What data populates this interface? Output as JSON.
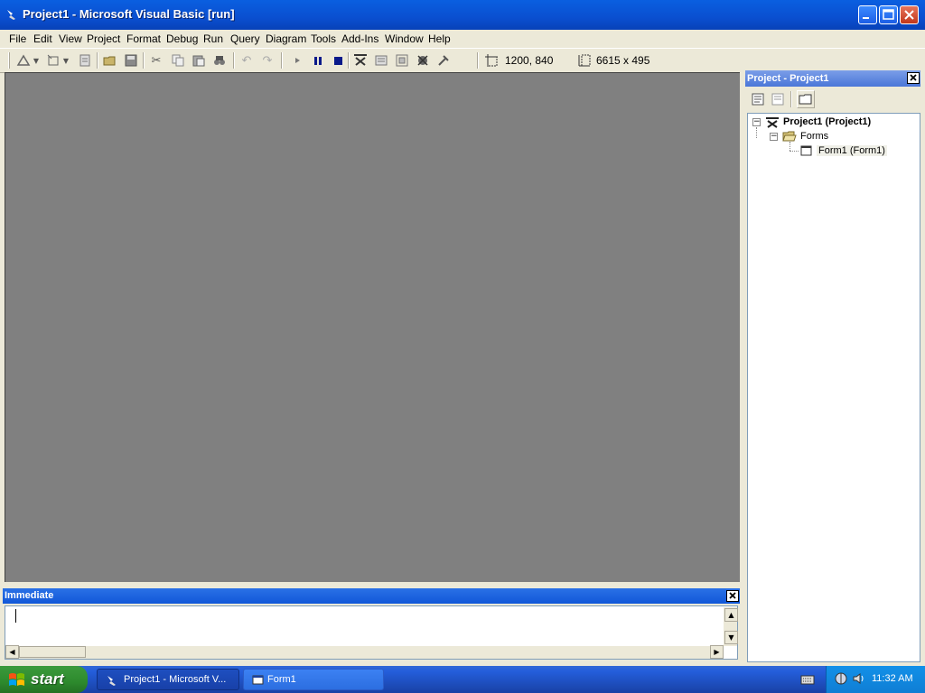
{
  "window": {
    "title": "Project1 - Microsoft Visual Basic [run]"
  },
  "menu": [
    {
      "label": "File"
    },
    {
      "label": "Edit"
    },
    {
      "label": "View"
    },
    {
      "label": "Project"
    },
    {
      "label": "Format"
    },
    {
      "label": "Debug"
    },
    {
      "label": "Run"
    },
    {
      "label": "Query"
    },
    {
      "label": "Diagram"
    },
    {
      "label": "Tools"
    },
    {
      "label": "Add-Ins"
    },
    {
      "label": "Window"
    },
    {
      "label": "Help"
    }
  ],
  "toolbar": {
    "position": "1200, 840",
    "size": "6615 x 495"
  },
  "immediate": {
    "title": "Immediate",
    "value": ""
  },
  "project_explorer": {
    "title": "Project - Project1",
    "root": "Project1 (Project1)",
    "folder": "Forms",
    "item": "Form1 (Form1)"
  },
  "taskbar": {
    "start_label": "start",
    "tasks": [
      {
        "label": "Project1 - Microsoft V..."
      },
      {
        "label": "Form1"
      }
    ],
    "clock": "11:32 AM"
  },
  "colors": {
    "titlebar": "#0a55de",
    "mdi_background": "#808080",
    "taskbar": "#245edb",
    "start_button": "#2d8a2d"
  }
}
